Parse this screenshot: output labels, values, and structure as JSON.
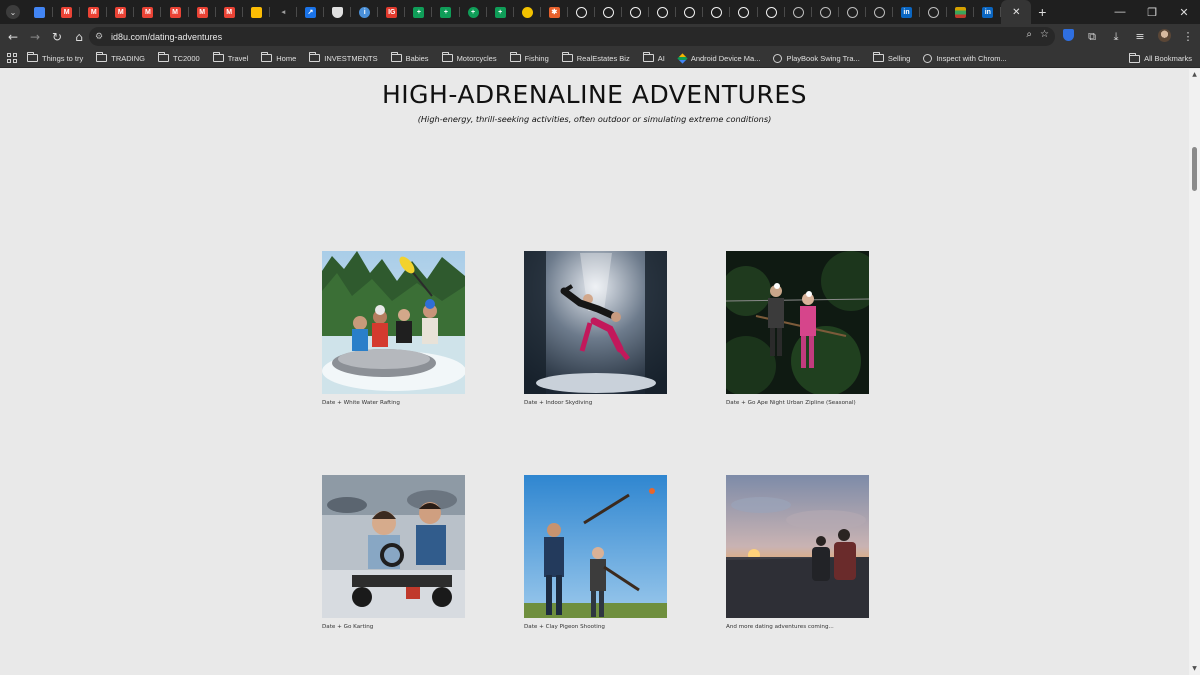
{
  "browser": {
    "tabs": [
      {
        "icon": "docs-icon",
        "color": "#4285f4",
        "letter": ""
      },
      {
        "icon": "gmail-icon",
        "color": "#ea4335",
        "letter": "M"
      },
      {
        "icon": "gmail-icon",
        "color": "#ea4335",
        "letter": "M"
      },
      {
        "icon": "gmail-icon",
        "color": "#ea4335",
        "letter": "M"
      },
      {
        "icon": "gmail-icon",
        "color": "#ea4335",
        "letter": "M"
      },
      {
        "icon": "gmail-icon",
        "color": "#ea4335",
        "letter": "M"
      },
      {
        "icon": "gmail-icon",
        "color": "#ea4335",
        "letter": "M"
      },
      {
        "icon": "gmail-icon",
        "color": "#ea4335",
        "letter": "M"
      },
      {
        "icon": "drive-icon",
        "color": "#fbbc04",
        "letter": ""
      },
      {
        "icon": "audio-icon",
        "color": "#9e9e9e",
        "letter": "◂"
      },
      {
        "icon": "chart-icon",
        "color": "#1a73e8",
        "letter": "↗"
      },
      {
        "icon": "shield-icon",
        "color": "#e0e0e0",
        "letter": ""
      },
      {
        "icon": "info-icon",
        "color": "#4a90d9",
        "letter": "i"
      },
      {
        "icon": "ig-icon",
        "color": "#e23b2e",
        "letter": "IG"
      },
      {
        "icon": "sheets-icon",
        "color": "#0f9d58",
        "letter": "+"
      },
      {
        "icon": "sheets-icon",
        "color": "#0f9d58",
        "letter": "+"
      },
      {
        "icon": "plus-circle-icon",
        "color": "#0f9d58",
        "letter": "+"
      },
      {
        "icon": "sheets-icon",
        "color": "#0f9d58",
        "letter": "+"
      },
      {
        "icon": "sun-icon",
        "color": "#f2c200",
        "letter": ""
      },
      {
        "icon": "burst-icon",
        "color": "#e8612c",
        "letter": "✱"
      },
      {
        "icon": "github-icon",
        "color": "#f0f0f0",
        "letter": ""
      },
      {
        "icon": "github-icon",
        "color": "#f0f0f0",
        "letter": ""
      },
      {
        "icon": "github-icon",
        "color": "#f0f0f0",
        "letter": ""
      },
      {
        "icon": "github-icon",
        "color": "#f0f0f0",
        "letter": ""
      },
      {
        "icon": "github-icon",
        "color": "#f0f0f0",
        "letter": ""
      },
      {
        "icon": "github-icon",
        "color": "#f0f0f0",
        "letter": ""
      },
      {
        "icon": "github-icon",
        "color": "#f0f0f0",
        "letter": ""
      },
      {
        "icon": "github-icon",
        "color": "#f0f0f0",
        "letter": ""
      },
      {
        "icon": "globe-icon",
        "color": "#bdbdbd",
        "letter": ""
      },
      {
        "icon": "globe-icon",
        "color": "#bdbdbd",
        "letter": ""
      },
      {
        "icon": "globe-icon",
        "color": "#bdbdbd",
        "letter": ""
      },
      {
        "icon": "globe-icon",
        "color": "#bdbdbd",
        "letter": ""
      },
      {
        "icon": "linkedin-icon",
        "color": "#0a66c2",
        "letter": "in"
      },
      {
        "icon": "globe-icon",
        "color": "#bdbdbd",
        "letter": ""
      },
      {
        "icon": "stripes-icon",
        "color": "#d6a100",
        "letter": ""
      },
      {
        "icon": "linkedin-icon",
        "color": "#0a66c2",
        "letter": "in"
      }
    ],
    "url": "id8u.com/dating-adventures",
    "bookmarks": [
      {
        "type": "folder",
        "label": "Things to try"
      },
      {
        "type": "folder",
        "label": "TRADING"
      },
      {
        "type": "folder",
        "label": "TC2000"
      },
      {
        "type": "folder",
        "label": "Travel"
      },
      {
        "type": "folder",
        "label": "Home"
      },
      {
        "type": "folder",
        "label": "INVESTMENTS"
      },
      {
        "type": "folder",
        "label": "Babies"
      },
      {
        "type": "folder",
        "label": "Motorcycles"
      },
      {
        "type": "folder",
        "label": "Fishing"
      },
      {
        "type": "folder",
        "label": "RealEstates Biz"
      },
      {
        "type": "folder",
        "label": "AI"
      },
      {
        "type": "android",
        "label": "Android Device Ma..."
      },
      {
        "type": "globe",
        "label": "PlayBook Swing Tra..."
      },
      {
        "type": "folder",
        "label": "Selling"
      },
      {
        "type": "globe",
        "label": "Inspect with Chrom..."
      }
    ],
    "all_bookmarks_label": "All Bookmarks"
  },
  "page": {
    "title": "HIGH-ADRENALINE ADVENTURES",
    "subtitle": "(High-energy, thrill-seeking activities, often outdoor or simulating extreme conditions)",
    "cards": [
      {
        "caption": "Date + White Water Rafting",
        "image": "rafting-photo"
      },
      {
        "caption": "Date + Indoor Skydiving",
        "image": "skydiving-photo"
      },
      {
        "caption": "Date + Go Ape Night Urban Zipline (Seasonal)",
        "image": "zipline-photo"
      },
      {
        "caption": "Date + Go Karting",
        "image": "karting-photo"
      },
      {
        "caption": "Date + Clay Pigeon Shooting",
        "image": "clay-shooting-photo"
      },
      {
        "caption": "And more dating adventures coming...",
        "image": "sunset-couple-photo"
      }
    ]
  }
}
